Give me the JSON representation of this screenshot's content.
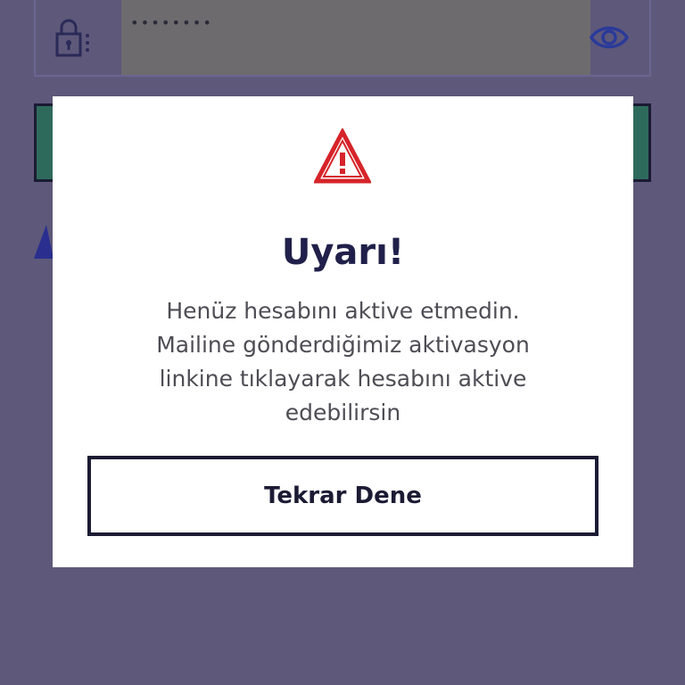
{
  "password_field": {
    "value": "••••••••",
    "lock_icon": "lock-icon",
    "eye_icon": "eye-icon"
  },
  "dialog": {
    "title": "Uyarı!",
    "message": "Henüz hesabını aktive etmedin. Mailine gönderdiğimiz aktivasyon linkine tıklayarak hesabını aktive edebilirsin",
    "retry_label": "Tekrar Dene",
    "icon": "warning-icon"
  },
  "colors": {
    "overlay": "#5e587a",
    "warning_red": "#d6242a",
    "text_dark": "#20204a",
    "background_button": "#2e6a5c"
  }
}
